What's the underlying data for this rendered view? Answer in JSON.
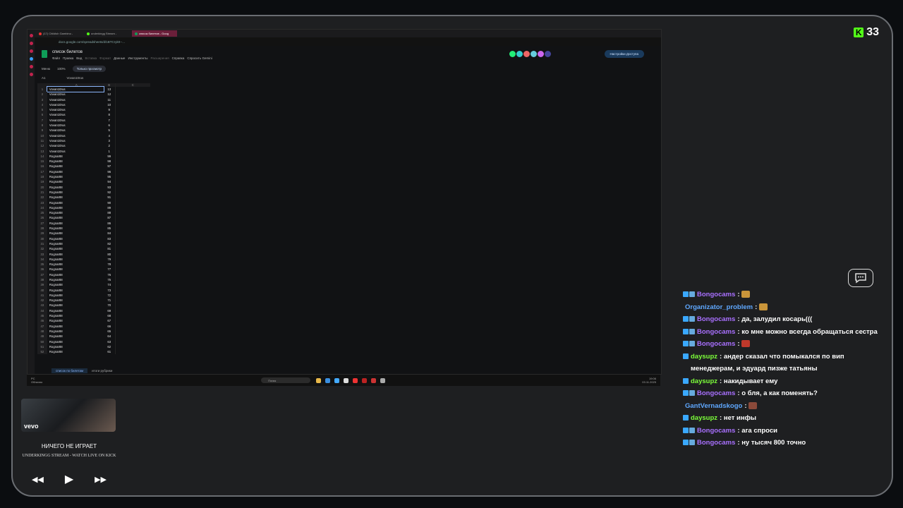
{
  "kick": {
    "viewers": "33"
  },
  "browser": {
    "tabs": [
      "(17) Childish Gambino - ",
      "underkingg Stream -",
      "список билетов - Goog"
    ],
    "url": "docs.google.com/spreadsheets/d/1BTCryk0--...",
    "doc_title": "список билетов",
    "menu": [
      "Файл",
      "Правка",
      "Вид",
      "Вставка",
      "Формат",
      "Данные",
      "Инструменты",
      "Расширения",
      "Справка",
      "Спросить Gemini"
    ],
    "access_label": "Настройки Доступа",
    "toolbar": {
      "menu": "Меню",
      "zoom": "100%",
      "view_only": "Только просмотр"
    },
    "formula": {
      "cell": "A1",
      "value": "Vovan10rus"
    },
    "columns": [
      "A",
      "B",
      "C"
    ],
    "rows": [
      [
        "1",
        "Vovan10rus",
        "13"
      ],
      [
        "2",
        "Vovan10rus",
        "12"
      ],
      [
        "3",
        "Vovan10rus",
        "11"
      ],
      [
        "4",
        "Vovan10rus",
        "10"
      ],
      [
        "5",
        "Vovan10rus",
        "9"
      ],
      [
        "6",
        "Vovan10rus",
        "8"
      ],
      [
        "7",
        "Vovan10rus",
        "7"
      ],
      [
        "8",
        "Vovan10rus",
        "6"
      ],
      [
        "9",
        "Vovan10rus",
        "5"
      ],
      [
        "10",
        "Vovan10rus",
        "4"
      ],
      [
        "11",
        "Vovan10rus",
        "3"
      ],
      [
        "12",
        "Vovan10rus",
        "2"
      ],
      [
        "13",
        "Vovan10rus",
        "1"
      ],
      [
        "14",
        "Rognar88",
        "99"
      ],
      [
        "15",
        "Rognar88",
        "98"
      ],
      [
        "16",
        "Rognar88",
        "97"
      ],
      [
        "17",
        "Rognar88",
        "96"
      ],
      [
        "18",
        "Rognar88",
        "95"
      ],
      [
        "19",
        "Rognar88",
        "94"
      ],
      [
        "20",
        "Rognar88",
        "93"
      ],
      [
        "21",
        "Rognar88",
        "92"
      ],
      [
        "22",
        "Rognar88",
        "91"
      ],
      [
        "23",
        "Rognar88",
        "90"
      ],
      [
        "24",
        "Rognar88",
        "89"
      ],
      [
        "25",
        "Rognar88",
        "88"
      ],
      [
        "26",
        "Rognar88",
        "87"
      ],
      [
        "27",
        "Rognar88",
        "86"
      ],
      [
        "28",
        "Rognar88",
        "85"
      ],
      [
        "29",
        "Rognar88",
        "84"
      ],
      [
        "30",
        "Rognar88",
        "83"
      ],
      [
        "31",
        "Rognar88",
        "82"
      ],
      [
        "32",
        "Rognar88",
        "81"
      ],
      [
        "33",
        "Rognar88",
        "80"
      ],
      [
        "34",
        "Rognar88",
        "79"
      ],
      [
        "35",
        "Rognar88",
        "78"
      ],
      [
        "36",
        "Rognar88",
        "77"
      ],
      [
        "37",
        "Rognar88",
        "76"
      ],
      [
        "38",
        "Rognar88",
        "75"
      ],
      [
        "39",
        "Rognar88",
        "74"
      ],
      [
        "40",
        "Rognar88",
        "73"
      ],
      [
        "41",
        "Rognar88",
        "72"
      ],
      [
        "42",
        "Rognar88",
        "71"
      ],
      [
        "43",
        "Rognar88",
        "70"
      ],
      [
        "44",
        "Rognar88",
        "69"
      ],
      [
        "45",
        "Rognar88",
        "68"
      ],
      [
        "46",
        "Rognar88",
        "67"
      ],
      [
        "47",
        "Rognar88",
        "66"
      ],
      [
        "48",
        "Rognar88",
        "65"
      ],
      [
        "49",
        "Rognar88",
        "64"
      ],
      [
        "50",
        "Rognar88",
        "63"
      ],
      [
        "51",
        "Rognar88",
        "62"
      ],
      [
        "52",
        "Rognar88",
        "61"
      ]
    ],
    "sheet_tabs": [
      "список по билетам",
      "итоги рубрики"
    ]
  },
  "taskbar": {
    "weather_temp": "PC",
    "weather_desc": "Облачно",
    "search": "Поиск",
    "time": "19:06",
    "date": "03.11.2025"
  },
  "music": {
    "status": "НИЧЕГО НЕ ИГРАЕТ",
    "subtitle": "UNDERKINGG STREAM - WATCH LIVE ON KICK",
    "brand": "vevo"
  },
  "chat": {
    "messages": [
      {
        "user": "Bongocams",
        "color": "#a970ff",
        "text": "",
        "emote": "#c9953a"
      },
      {
        "user": "Organizator_problem",
        "color": "#5fa8ff",
        "text": "",
        "emote": "#c9953a",
        "nobadge": true
      },
      {
        "user": "Bongocams",
        "color": "#a970ff",
        "text": "да, залудил косарь((("
      },
      {
        "user": "Bongocams",
        "color": "#a970ff",
        "text": "ко мне можно всегда обращаться сестра"
      },
      {
        "user": "Bongocams",
        "color": "#a970ff",
        "text": "",
        "emote": "#c0392b"
      },
      {
        "user": "daysupz",
        "color": "#7dff3a",
        "text": "андер сказал что помыкался по вип менеджерам, и эдуард пизже татьяны",
        "single": true
      },
      {
        "user": "daysupz",
        "color": "#7dff3a",
        "text": "накидывает ему",
        "single": true
      },
      {
        "user": "Bongocams",
        "color": "#a970ff",
        "text": "о бля, а как поменять?"
      },
      {
        "user": "GantVernadskogo",
        "color": "#5fa8ff",
        "text": "",
        "emote": "#8b4a3a",
        "nobadge": true
      },
      {
        "user": "daysupz",
        "color": "#7dff3a",
        "text": "нет инфы",
        "single": true
      },
      {
        "user": "Bongocams",
        "color": "#a970ff",
        "text": "ага спроси"
      },
      {
        "user": "Bongocams",
        "color": "#a970ff",
        "text": "ну тысяч 800 точно"
      }
    ]
  }
}
